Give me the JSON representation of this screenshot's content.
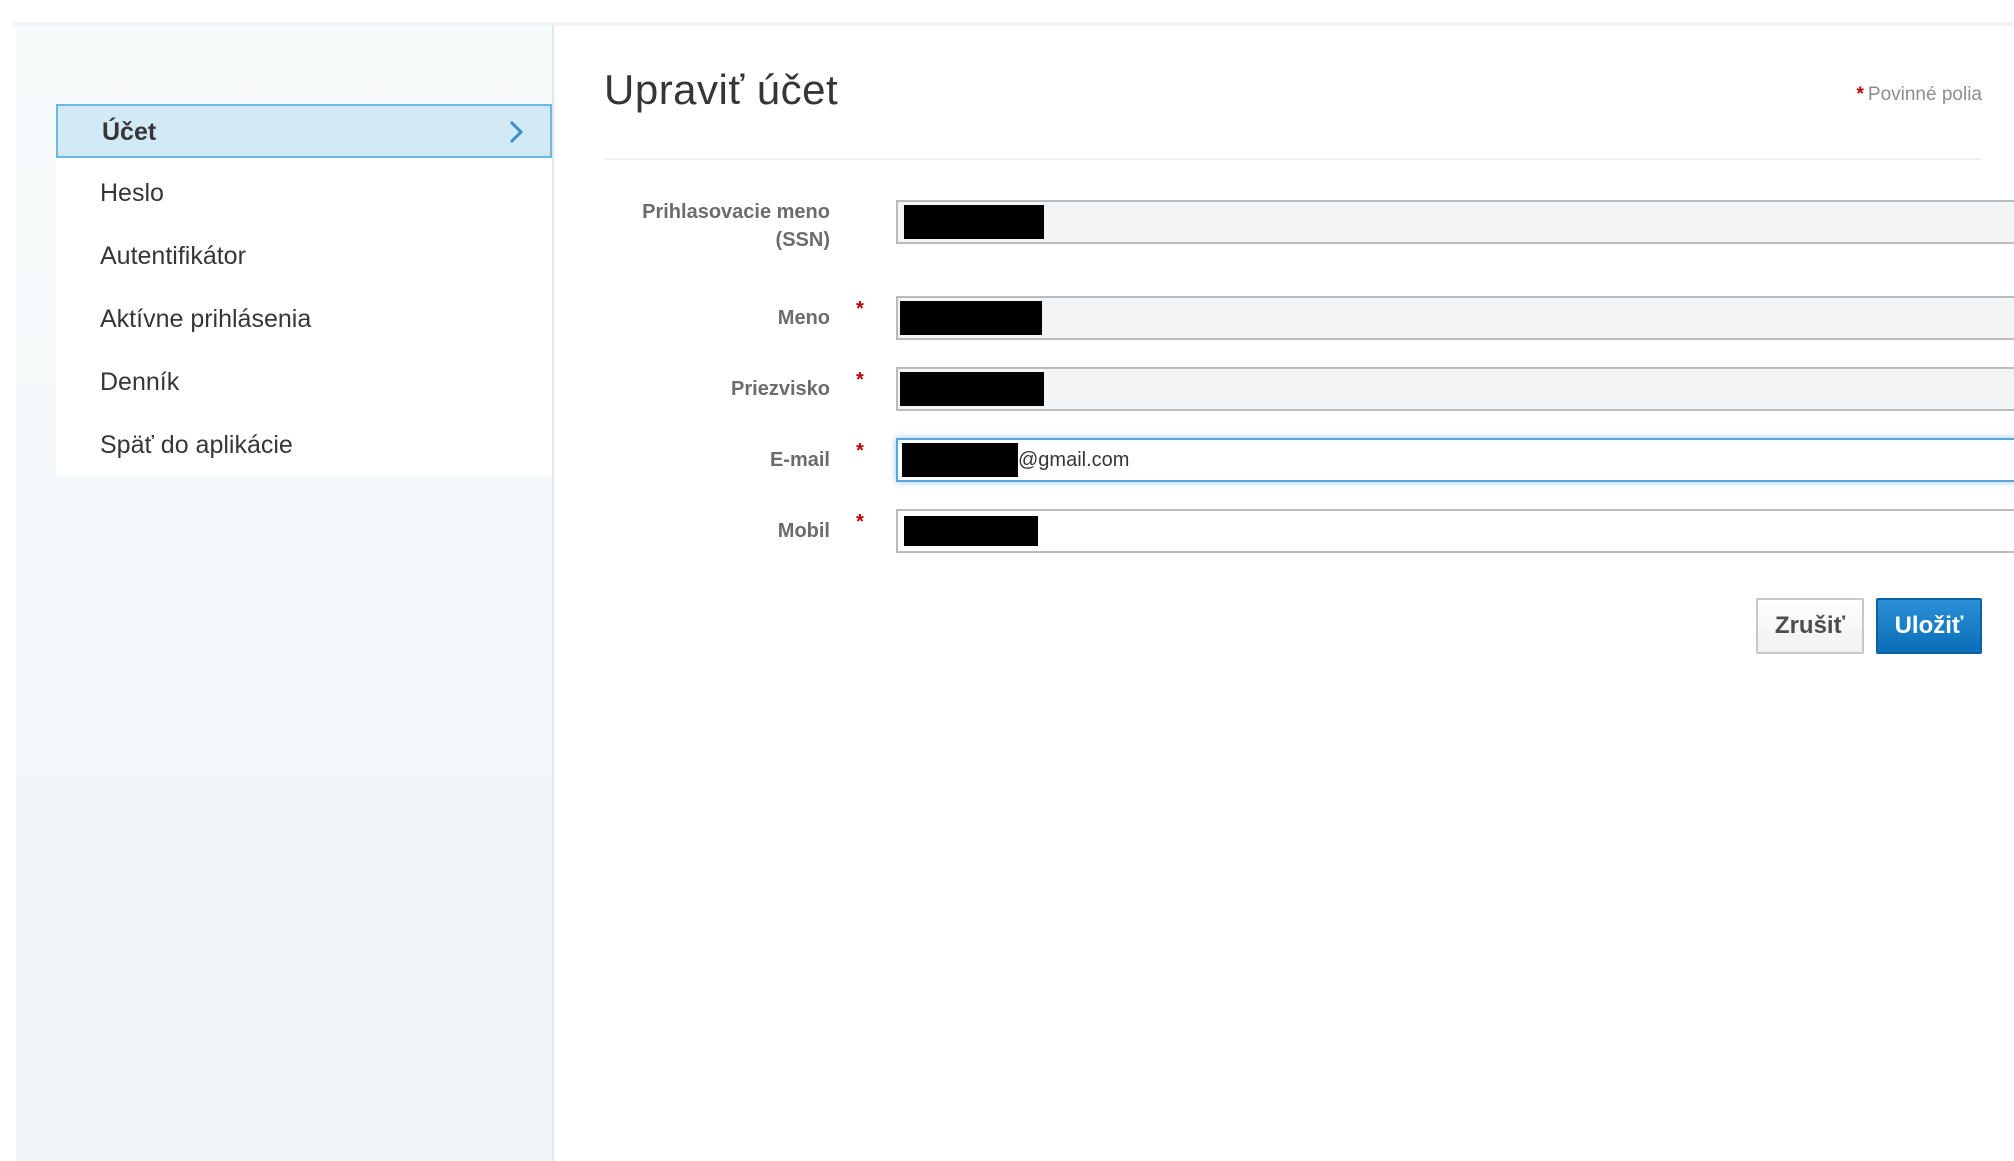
{
  "sidebar": {
    "items": [
      {
        "label": "Účet"
      },
      {
        "label": "Heslo"
      },
      {
        "label": "Autentifikátor"
      },
      {
        "label": "Aktívne prihlásenia"
      },
      {
        "label": "Denník"
      },
      {
        "label": "Späť do aplikácie"
      }
    ],
    "active_index": 0
  },
  "main": {
    "title": "Upraviť účet",
    "required_star": "*",
    "required_note": "Povinné polia",
    "fields": [
      {
        "label": "Prihlasovacie meno (SSN)",
        "required": false,
        "value": "",
        "editable": false
      },
      {
        "label": "Meno",
        "required": true,
        "value": "",
        "editable": false
      },
      {
        "label": "Priezvisko",
        "required": true,
        "value": "",
        "editable": false
      },
      {
        "label": "E-mail",
        "required": true,
        "value": "@gmail.com",
        "editable": true,
        "focused": true
      },
      {
        "label": "Mobil",
        "required": true,
        "value": "",
        "editable": true
      }
    ],
    "buttons": {
      "cancel": "Zrušiť",
      "save": "Uložiť"
    }
  },
  "colors": {
    "accent": "#0a6fb8",
    "active_nav_bg": "#d1eaf6",
    "active_nav_border": "#69b9e3",
    "required": "#c00000"
  }
}
